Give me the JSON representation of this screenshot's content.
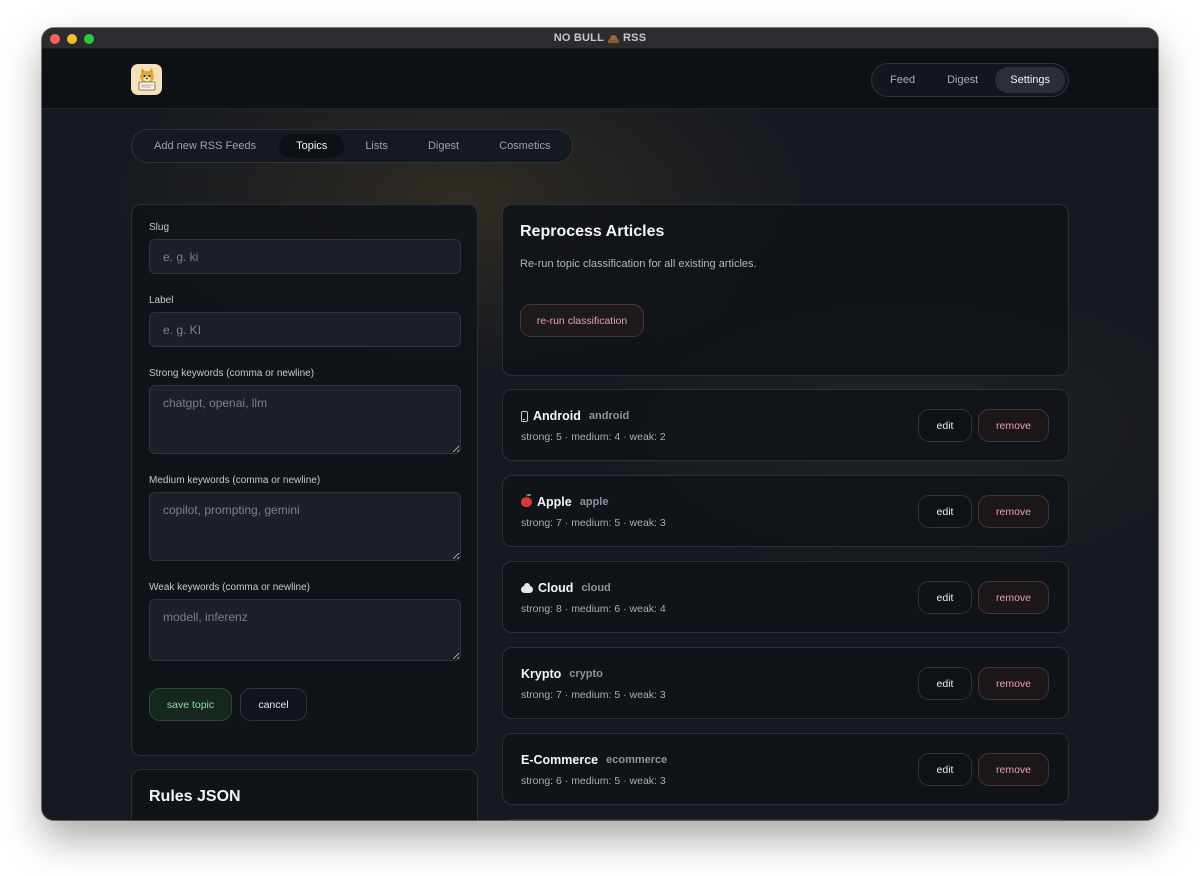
{
  "window": {
    "title": "NO BULL",
    "title_suffix": "RSS",
    "title_icon": "poo-icon"
  },
  "header": {
    "logo_icon": "doge-newspaper-logo",
    "nav": [
      {
        "label": "Feed",
        "active": false
      },
      {
        "label": "Digest",
        "active": false
      },
      {
        "label": "Settings",
        "active": true
      }
    ]
  },
  "subnav": {
    "tabs": [
      {
        "label": "Add new RSS Feeds",
        "active": false
      },
      {
        "label": "Topics",
        "active": true
      },
      {
        "label": "Lists",
        "active": false
      },
      {
        "label": "Digest",
        "active": false
      },
      {
        "label": "Cosmetics",
        "active": false
      }
    ]
  },
  "form": {
    "slug": {
      "label": "Slug",
      "value": "",
      "placeholder": "e. g. ki"
    },
    "label": {
      "label": "Label",
      "value": "",
      "placeholder": "e. g. KI"
    },
    "strong": {
      "label": "Strong keywords (comma or newline)",
      "value": "",
      "placeholder": "chatgpt, openai, llm"
    },
    "medium": {
      "label": "Medium keywords (comma or newline)",
      "value": "",
      "placeholder": "copilot, prompting, gemini"
    },
    "weak": {
      "label": "Weak keywords (comma or newline)",
      "value": "",
      "placeholder": "modell, inferenz"
    },
    "save_label": "save topic",
    "cancel_label": "cancel"
  },
  "rules": {
    "title": "Rules JSON"
  },
  "reprocess": {
    "title": "Reprocess Articles",
    "description": "Re-run topic classification for all existing articles.",
    "button_label": "re-run classification"
  },
  "topics": [
    {
      "icon": "phone-icon",
      "label": "Android",
      "slug": "android",
      "stats": "strong: 5 · medium: 4 · weak: 2"
    },
    {
      "icon": "apple-icon",
      "label": "Apple",
      "slug": "apple",
      "stats": "strong: 7 · medium: 5 · weak: 3"
    },
    {
      "icon": "cloud-icon",
      "label": "Cloud",
      "slug": "cloud",
      "stats": "strong: 8 · medium: 6 · weak: 4"
    },
    {
      "icon": "",
      "label": "Krypto",
      "slug": "crypto",
      "stats": "strong: 7 · medium: 5 · weak: 3"
    },
    {
      "icon": "",
      "label": "E-Commerce",
      "slug": "ecommerce",
      "stats": "strong: 6 · medium: 5 · weak: 3"
    }
  ],
  "topic_actions": {
    "edit_label": "edit",
    "remove_label": "remove"
  },
  "colors": {
    "background": "#151920",
    "header": "#0d1015",
    "card": "#101319",
    "save_accent": "#8fd9a1",
    "danger_accent": "#e8a0aa"
  }
}
